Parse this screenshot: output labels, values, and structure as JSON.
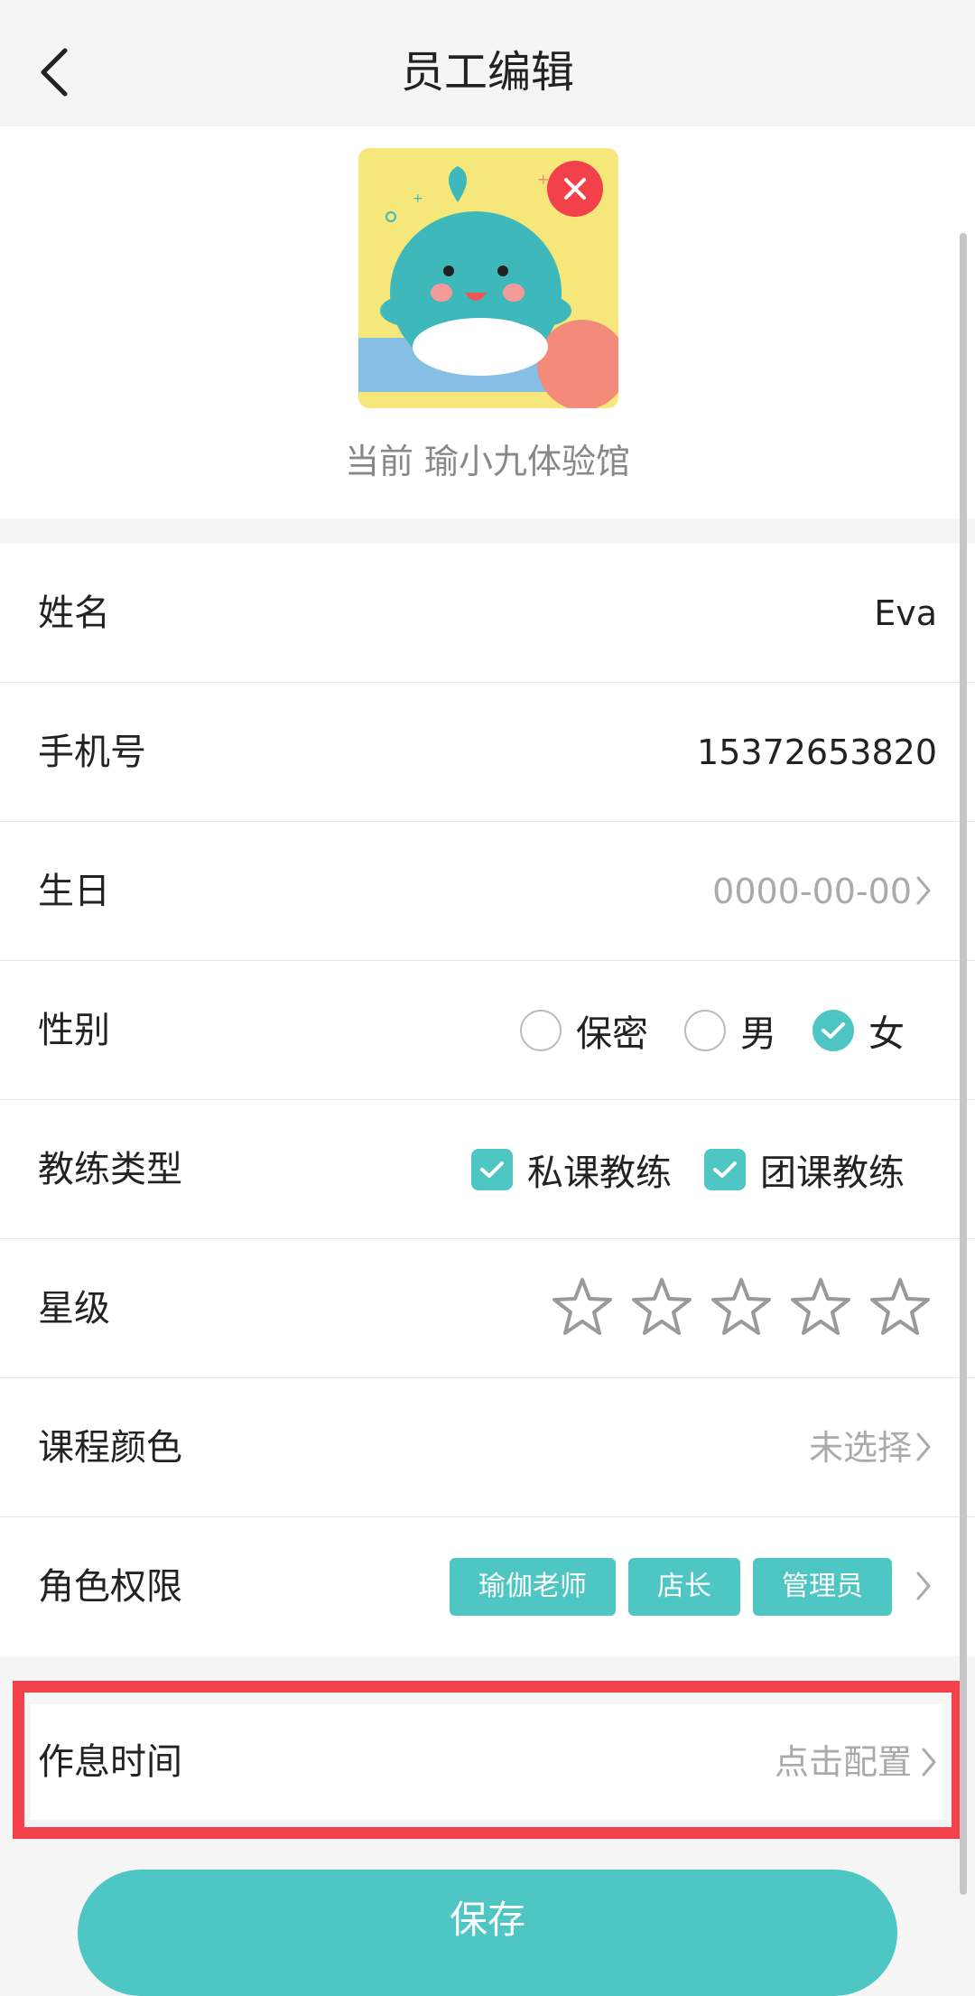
{
  "header": {
    "title": "员工编辑",
    "back_icon": "chevron-left-icon"
  },
  "avatar": {
    "image": "whale-cartoon-avatar",
    "delete_icon": "close-icon",
    "store_text": "当前 瑜小九体验馆"
  },
  "form": {
    "name": {
      "label": "姓名",
      "value": "Eva"
    },
    "phone": {
      "label": "手机号",
      "value": "15372653820"
    },
    "birthday": {
      "label": "生日",
      "placeholder": "0000-00-00"
    },
    "gender": {
      "label": "性别",
      "options": [
        {
          "label": "保密",
          "selected": false
        },
        {
          "label": "男",
          "selected": false
        },
        {
          "label": "女",
          "selected": true
        }
      ]
    },
    "coach_type": {
      "label": "教练类型",
      "options": [
        {
          "label": "私课教练",
          "checked": true
        },
        {
          "label": "团课教练",
          "checked": true
        }
      ]
    },
    "rating": {
      "label": "星级",
      "stars": 0,
      "max": 5
    },
    "course_color": {
      "label": "课程颜色",
      "placeholder": "未选择"
    },
    "role": {
      "label": "角色权限",
      "tags": [
        "瑜伽老师",
        "店长",
        "管理员"
      ]
    },
    "sleep_time": {
      "label": "作息时间",
      "placeholder": "点击配置"
    }
  },
  "save_button": {
    "label": "保存"
  },
  "colors": {
    "accent": "#4ec6c4",
    "highlight": "#f2414b",
    "background": "#f5f5f5"
  }
}
